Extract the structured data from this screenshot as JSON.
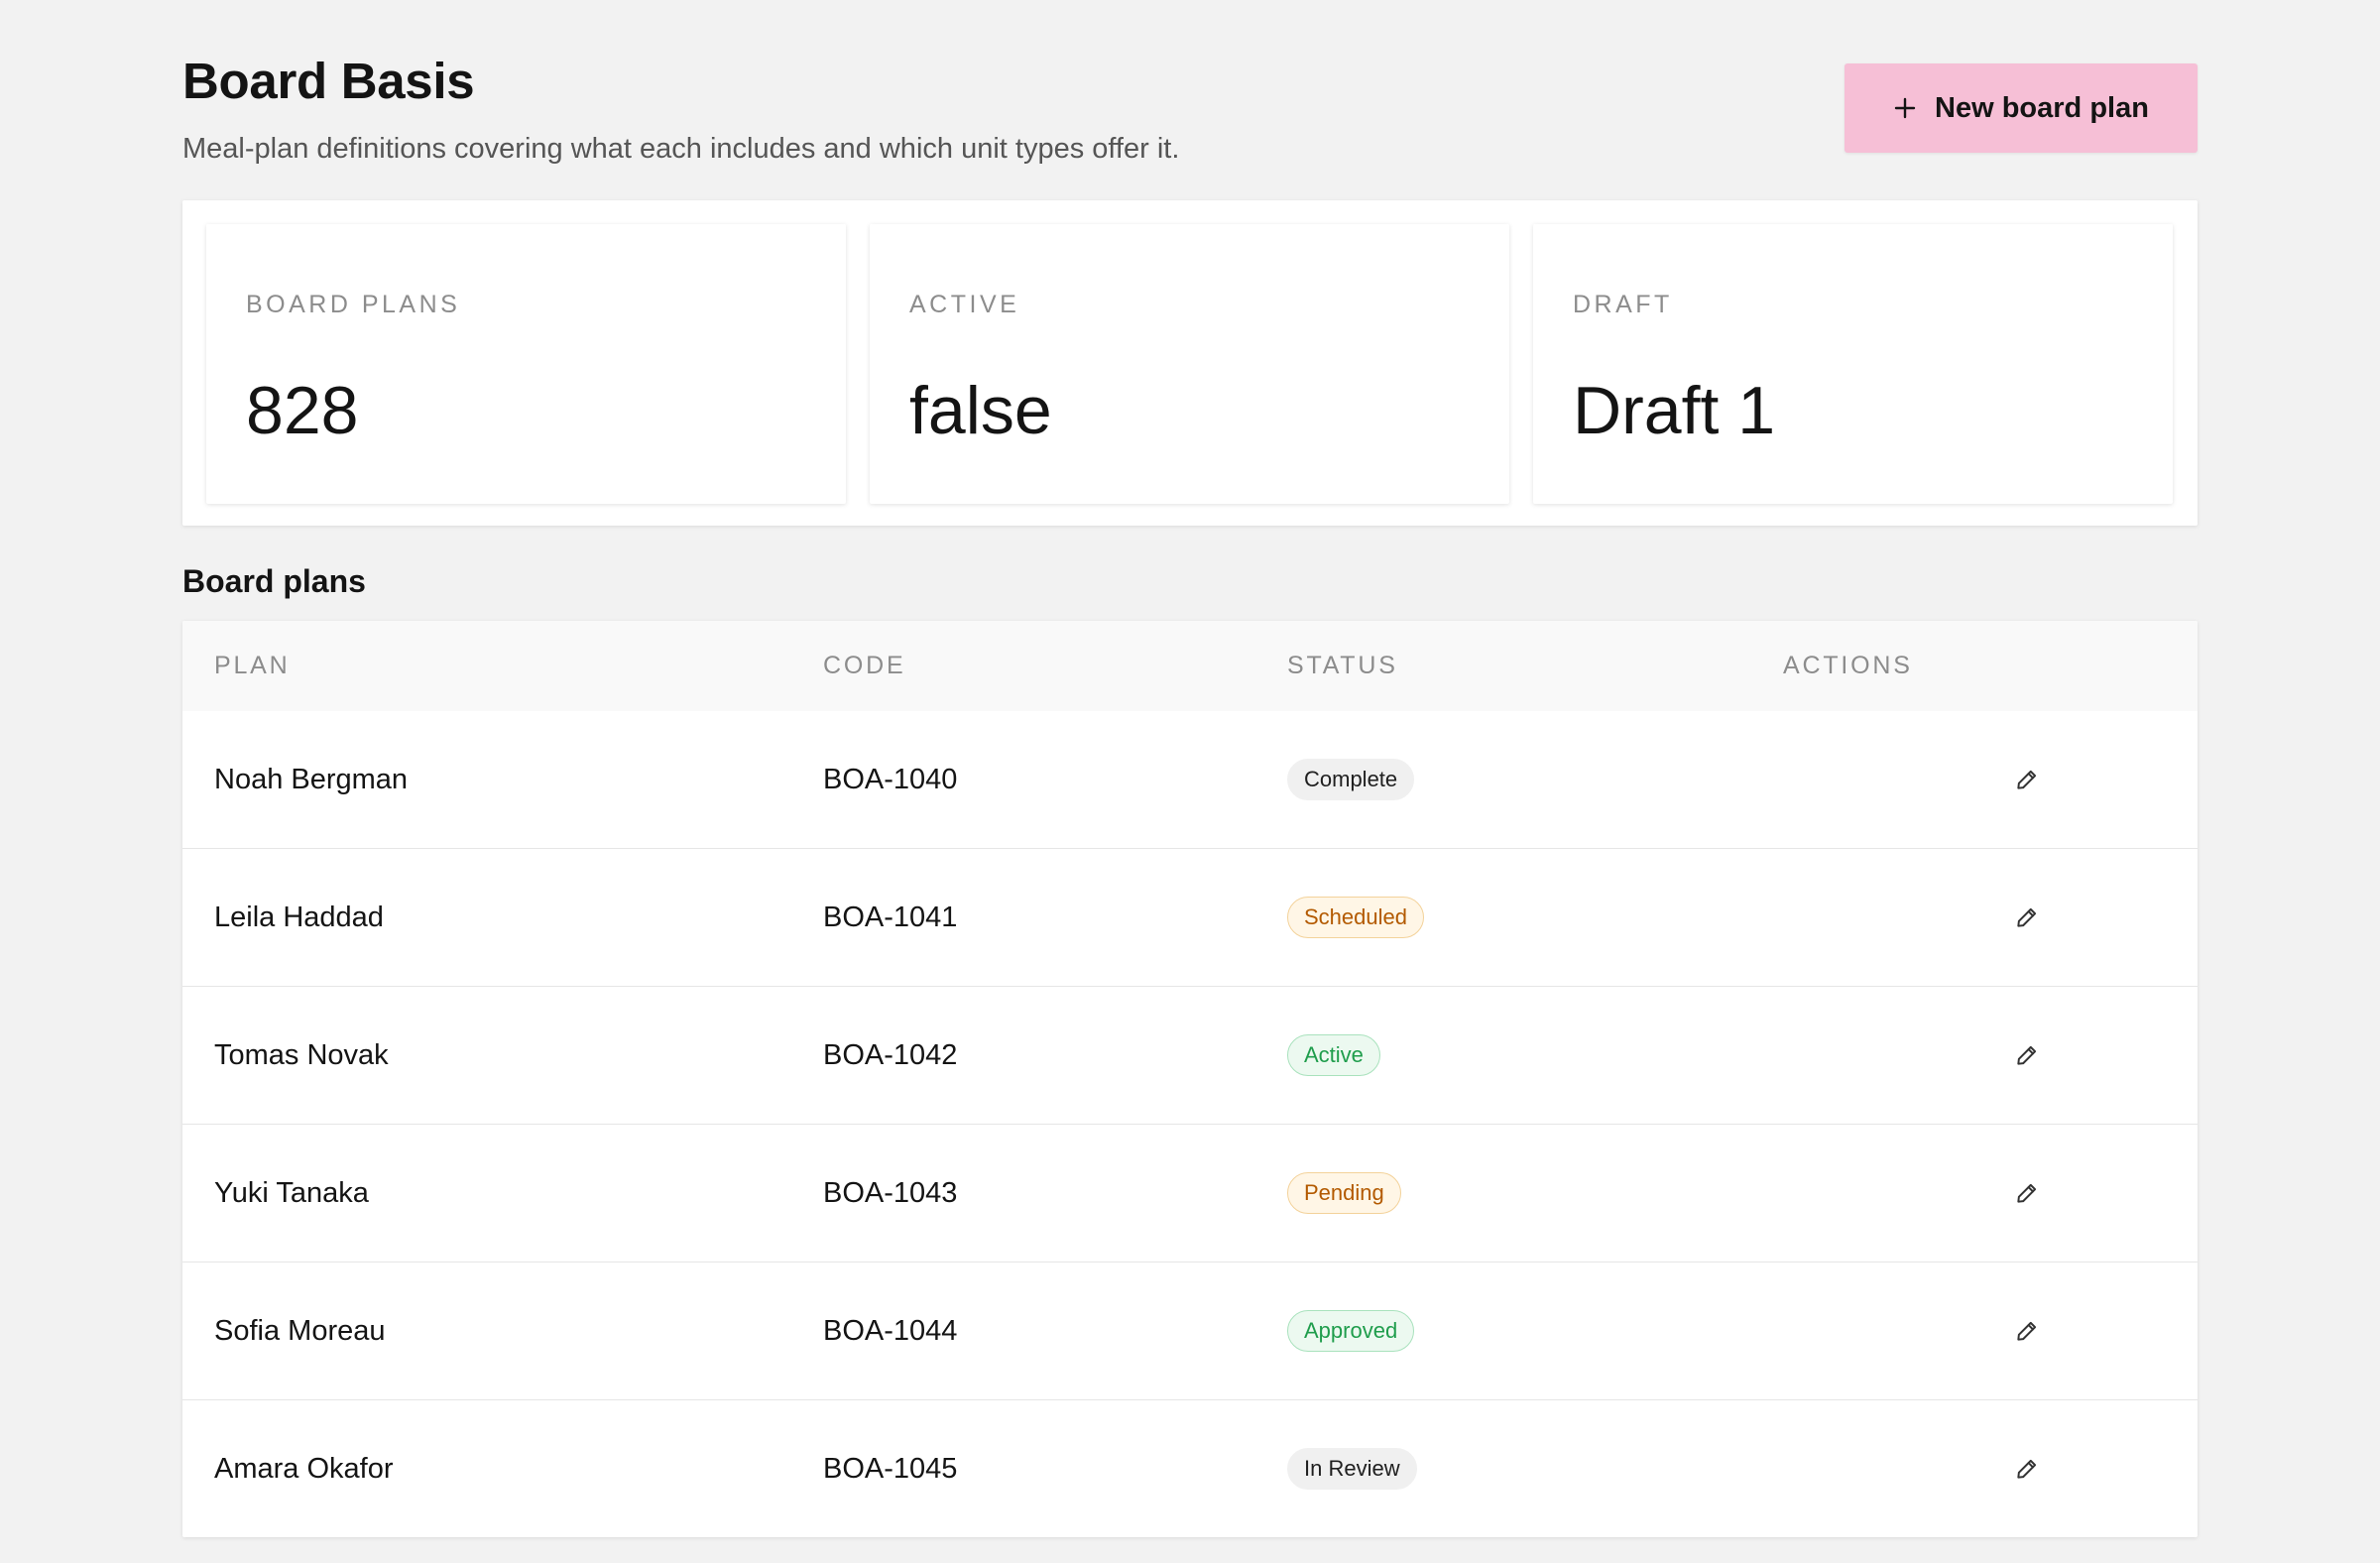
{
  "header": {
    "title": "Board Basis",
    "subtitle": "Meal-plan definitions covering what each includes and which unit types offer it.",
    "new_button_label": "New board plan",
    "new_button_icon": "plus-icon",
    "new_button_color": "#f6bfd6"
  },
  "stats": [
    {
      "label": "BOARD PLANS",
      "value": "828"
    },
    {
      "label": "ACTIVE",
      "value": "false"
    },
    {
      "label": "DRAFT",
      "value": "Draft 1"
    }
  ],
  "table": {
    "title": "Board plans",
    "columns": [
      "PLAN",
      "CODE",
      "STATUS",
      "ACTIONS"
    ],
    "rows": [
      {
        "plan": "Noah Bergman",
        "code": "BOA-1040",
        "status": "Complete",
        "status_tone": "neutral",
        "action_icon": "pencil-icon"
      },
      {
        "plan": "Leila Haddad",
        "code": "BOA-1041",
        "status": "Scheduled",
        "status_tone": "warn",
        "action_icon": "pencil-icon"
      },
      {
        "plan": "Tomas Novak",
        "code": "BOA-1042",
        "status": "Active",
        "status_tone": "success",
        "action_icon": "pencil-icon"
      },
      {
        "plan": "Yuki Tanaka",
        "code": "BOA-1043",
        "status": "Pending",
        "status_tone": "warn",
        "action_icon": "pencil-icon"
      },
      {
        "plan": "Sofia Moreau",
        "code": "BOA-1044",
        "status": "Approved",
        "status_tone": "success",
        "action_icon": "pencil-icon"
      },
      {
        "plan": "Amara Okafor",
        "code": "BOA-1045",
        "status": "In Review",
        "status_tone": "neutral",
        "action_icon": "pencil-icon"
      }
    ]
  },
  "colors": {
    "background": "#f2f2f2",
    "accent": "#f6bfd6",
    "warn_text": "#b35a00",
    "success_text": "#1f9d4c"
  }
}
